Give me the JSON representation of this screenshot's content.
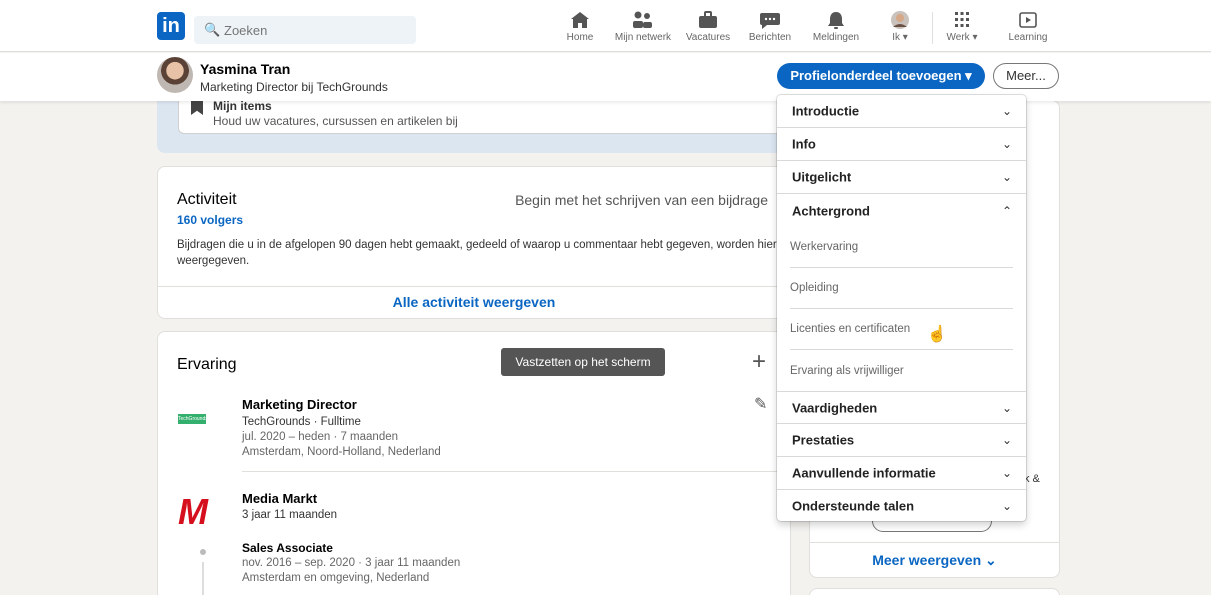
{
  "nav": {
    "search_placeholder": "Zoeken",
    "items": [
      {
        "label": "Home",
        "icon": "home-icon"
      },
      {
        "label": "Mijn netwerk",
        "icon": "network-icon"
      },
      {
        "label": "Vacatures",
        "icon": "briefcase-icon"
      },
      {
        "label": "Berichten",
        "icon": "messages-icon"
      },
      {
        "label": "Meldingen",
        "icon": "bell-icon"
      },
      {
        "label": "Ik",
        "icon": "avatar-icon"
      },
      {
        "label": "Werk",
        "icon": "grid-icon"
      },
      {
        "label": "Learning",
        "icon": "learning-icon"
      }
    ]
  },
  "profile": {
    "name": "Yasmina Tran",
    "title": "Marketing Director bij TechGrounds",
    "add_section": "Profielonderdeel toevoegen",
    "more": "Meer..."
  },
  "my_items": {
    "title": "Mijn items",
    "desc": "Houd uw vacatures, cursussen en artikelen bij"
  },
  "activity": {
    "title": "Activiteit",
    "start_post": "Begin met het schrijven van een bijdrage",
    "followers": "160 volgers",
    "desc": "Bijdragen die u in de afgelopen 90 dagen hebt gemaakt, gedeeld of waarop u commentaar hebt gegeven, worden hier weergegeven.",
    "show_all": "Alle activiteit weergeven"
  },
  "experience": {
    "title": "Ervaring",
    "tooltip": "Vastzetten op het scherm",
    "jobs": [
      {
        "title": "Marketing Director",
        "company_line": "TechGrounds · Fulltime",
        "period": "jul. 2020 – heden · 7 maanden",
        "location": "Amsterdam, Noord-Holland, Nederland",
        "logo_text": "TechGrounds"
      },
      {
        "title": "Media Markt",
        "company_line": "3 jaar 11 maanden",
        "logo_text": "M"
      }
    ],
    "sub_role": {
      "title": "Sales Associate",
      "period": "nov. 2016 – sep. 2020 · 3 jaar 11 maanden",
      "location": "Amsterdam en omgeving, Nederland"
    }
  },
  "right": {
    "show_more": "Meer weergeven",
    "snippet": "k &"
  },
  "dropdown": {
    "sections": [
      {
        "label": "Introductie",
        "expanded": false
      },
      {
        "label": "Info",
        "expanded": false
      },
      {
        "label": "Uitgelicht",
        "expanded": false
      },
      {
        "label": "Achtergrond",
        "expanded": true
      },
      {
        "label": "Vaardigheden",
        "expanded": false
      },
      {
        "label": "Prestaties",
        "expanded": false
      },
      {
        "label": "Aanvullende informatie",
        "expanded": false
      },
      {
        "label": "Ondersteunde talen",
        "expanded": false
      }
    ],
    "background_items": [
      "Werkervaring",
      "Opleiding",
      "Licenties en certificaten",
      "Ervaring als vrijwilliger"
    ]
  },
  "colors": {
    "accent": "#0a66c2",
    "background": "#f3f2ef"
  }
}
